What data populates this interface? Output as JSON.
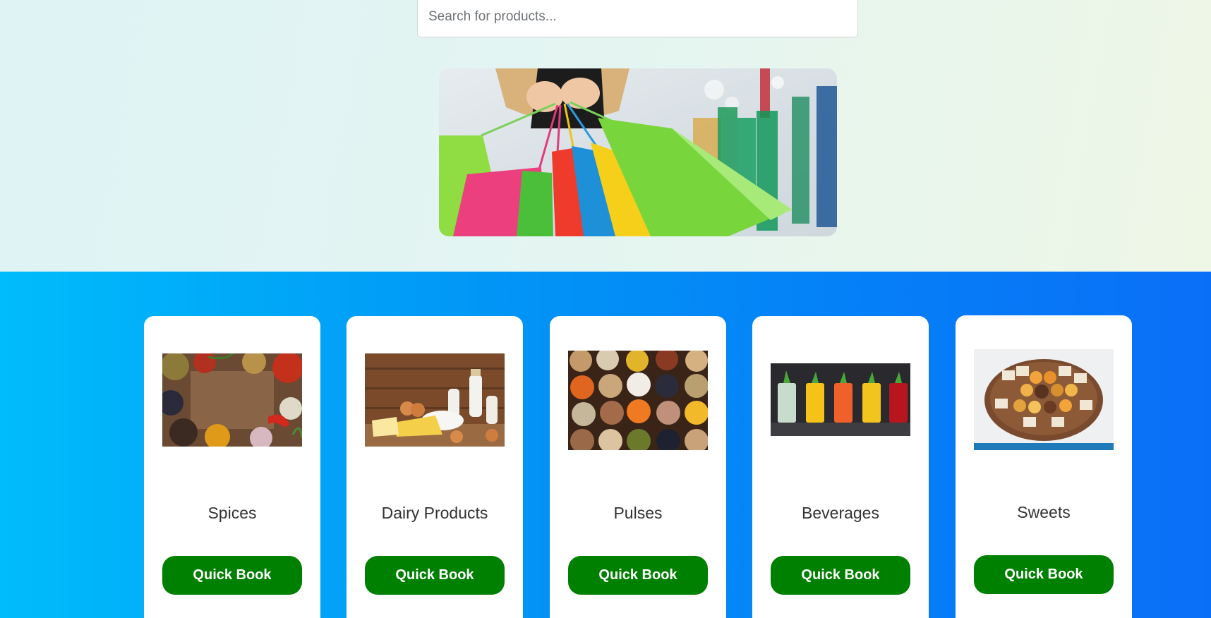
{
  "search": {
    "placeholder": "Search for products..."
  },
  "colors": {
    "accent_button": "#008000",
    "band": "#0196f6"
  },
  "products": [
    {
      "name": "Spices",
      "button_label": "Quick Book",
      "image_icon": "spices-photo"
    },
    {
      "name": "Dairy Products",
      "button_label": "Quick Book",
      "image_icon": "dairy-photo"
    },
    {
      "name": "Pulses",
      "button_label": "Quick Book",
      "image_icon": "pulses-photo"
    },
    {
      "name": "Beverages",
      "button_label": "Quick Book",
      "image_icon": "beverages-photo"
    },
    {
      "name": "Sweets",
      "button_label": "Quick Book",
      "image_icon": "sweets-photo"
    }
  ]
}
